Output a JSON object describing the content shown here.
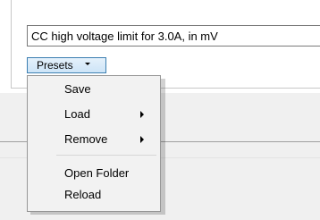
{
  "fields": {
    "previous_row_text": "",
    "description_text": "CC high voltage limit for 3.0A, in mV"
  },
  "presets_button": {
    "label": "Presets"
  },
  "presets_menu": {
    "items": [
      {
        "label": "Save",
        "has_submenu": false
      },
      {
        "label": "Load",
        "has_submenu": true
      },
      {
        "label": "Remove",
        "has_submenu": true
      },
      {
        "label": "Open Folder",
        "has_submenu": false
      },
      {
        "label": "Reload",
        "has_submenu": false
      }
    ]
  },
  "colors": {
    "menu_background": "#f2f2f2",
    "menu_border": "#979797",
    "button_border": "#3c7fb1",
    "button_fill": "#cde4f7",
    "window_background": "#f0f0f0"
  }
}
